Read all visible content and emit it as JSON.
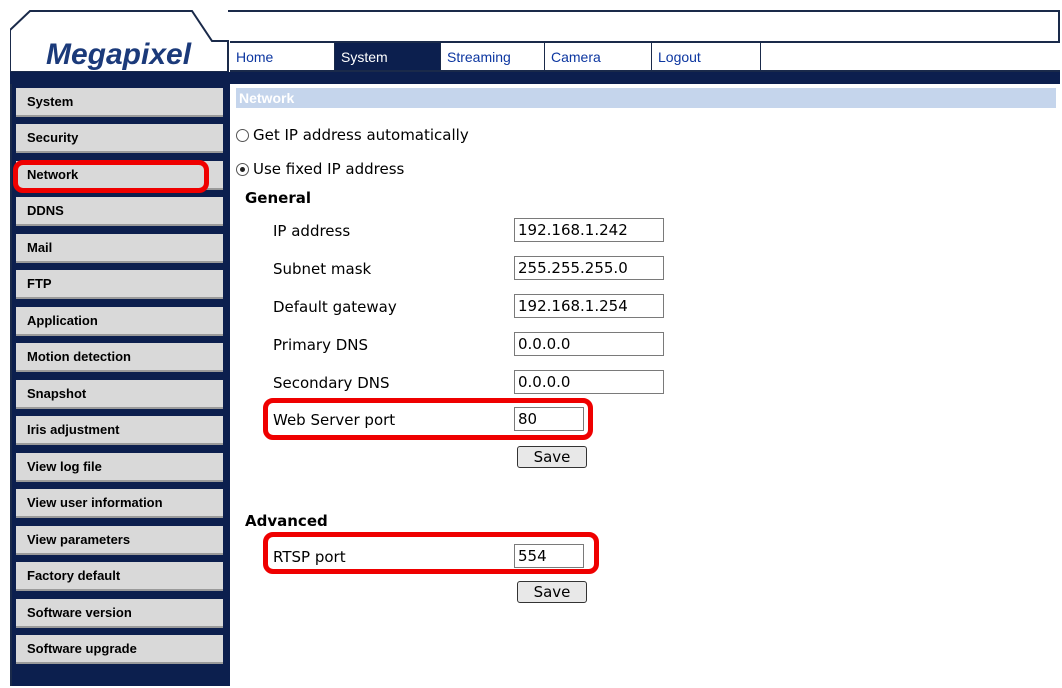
{
  "logo": "Megapixel",
  "top_nav": [
    {
      "label": "Home"
    },
    {
      "label": "System"
    },
    {
      "label": "Streaming"
    },
    {
      "label": "Camera"
    },
    {
      "label": "Logout"
    }
  ],
  "sidebar": [
    "System",
    "Security",
    "Network",
    "DDNS",
    "Mail",
    "FTP",
    "Application",
    "Motion detection",
    "Snapshot",
    "Iris adjustment",
    "View log file",
    "View user information",
    "View parameters",
    "Factory default",
    "Software version",
    "Software upgrade"
  ],
  "section_title": "Network",
  "ip_mode": {
    "auto_label": "Get IP address automatically",
    "fixed_label": "Use fixed IP address",
    "selected": "fixed"
  },
  "general": {
    "title": "General",
    "fields": [
      {
        "label": "IP address",
        "value": "192.168.1.242"
      },
      {
        "label": "Subnet mask",
        "value": "255.255.255.0"
      },
      {
        "label": "Default gateway",
        "value": "192.168.1.254"
      },
      {
        "label": "Primary DNS",
        "value": "0.0.0.0"
      },
      {
        "label": "Secondary DNS",
        "value": "0.0.0.0"
      },
      {
        "label": "Web Server port",
        "value": "80"
      }
    ],
    "save_label": "Save"
  },
  "advanced": {
    "title": "Advanced",
    "rtsp_label": "RTSP port",
    "rtsp_value": "554",
    "save_label": "Save"
  },
  "colors": {
    "navy": "#0c1f4e",
    "highlight": "#ef0000",
    "section_header": "#c5d5ec"
  }
}
